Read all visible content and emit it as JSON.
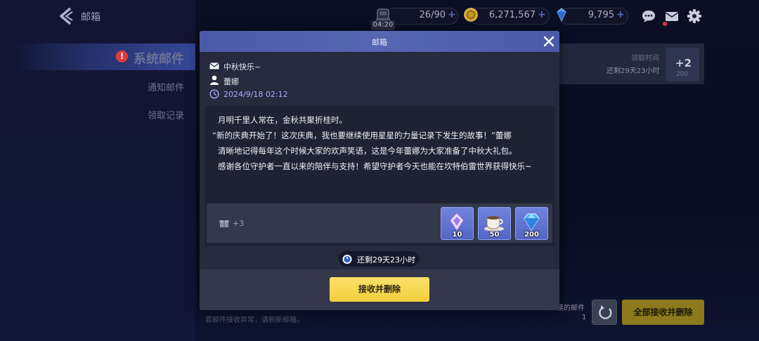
{
  "header": {
    "title": "邮箱",
    "stamina": {
      "value": "26/90",
      "timer": "04:20"
    },
    "gold": {
      "value": "6,271,567"
    },
    "gems": {
      "value": "9,795"
    },
    "plus": "+",
    "icons": [
      "chat-icon",
      "mail-icon",
      "gear-icon"
    ]
  },
  "sidebar": {
    "active": "系统邮件",
    "items": [
      {
        "label": "通知邮件"
      },
      {
        "label": "领取记录"
      }
    ],
    "warn_glyph": "!"
  },
  "background_row": {
    "label1": "领取时间",
    "label2": "还剩29天23小时",
    "badge": "+2",
    "badge_sub": "200"
  },
  "bottom": {
    "hint": "若邮件接收异常，请刷新邮箱。",
    "unread_label": "读的邮件",
    "unread_count": "1",
    "claim_all": "全部接收并删除"
  },
  "modal": {
    "title": "邮箱",
    "subject": "中秋快乐~",
    "sender": "蕾娜",
    "date": "2024/9/18 02:12",
    "body": [
      "月明千里人常在，金秋共聚折桂时。",
      "“新的庆典开始了！这次庆典，我也要继续使用星星的力量记录下发生的故事！”蕾娜",
      "清晰地记得每年这个时候大家的欢声笑语，这是今年蕾娜为大家准备了中秋大礼包。",
      "感谢各位守护者一直以来的陪伴与支持！希望守护者今天也能在坎特伯雷世界获得快乐~"
    ],
    "gift_count": "+3",
    "rewards": [
      {
        "icon": "crystal-icon",
        "count": "10"
      },
      {
        "icon": "coffee-cup-icon",
        "count": "50"
      },
      {
        "icon": "gem-icon",
        "count": "200"
      }
    ],
    "expiry": "还剩29天23小时",
    "confirm": "接收并删除"
  },
  "colors": {
    "accent_header": "#5566b3",
    "confirm_yellow": "#f3cf3c",
    "reward_blue": "#5a6dcc",
    "date_purple": "#b9a8ff",
    "alert_red": "#e03a3a"
  }
}
